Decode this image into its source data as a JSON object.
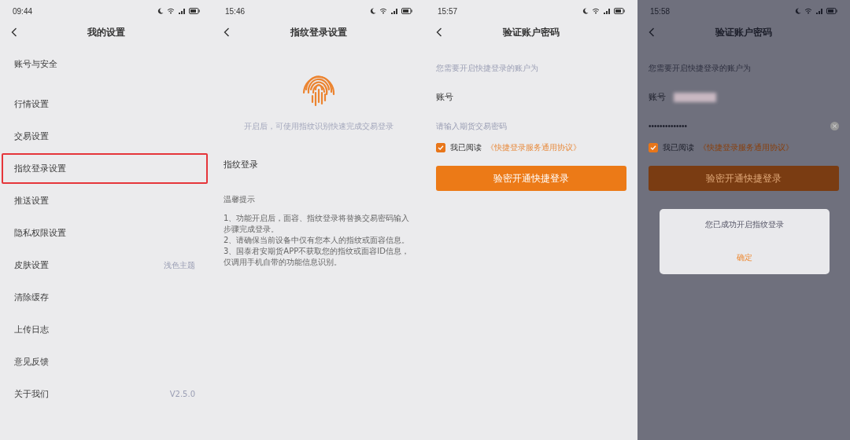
{
  "screens": [
    {
      "kind": "settings",
      "time": "09:44",
      "title": "我的设置",
      "items": [
        {
          "label": "账号与安全",
          "highlighted": false
        },
        {
          "label": "行情设置",
          "highlighted": false
        },
        {
          "label": "交易设置",
          "highlighted": false
        },
        {
          "label": "指纹登录设置",
          "highlighted": true
        },
        {
          "label": "推送设置",
          "highlighted": false
        },
        {
          "label": "隐私权限设置",
          "highlighted": false
        },
        {
          "label": "皮肤设置",
          "value": "浅色主题",
          "highlighted": false
        },
        {
          "label": "清除缓存",
          "highlighted": false
        },
        {
          "label": "上传日志",
          "highlighted": false
        },
        {
          "label": "意见反馈",
          "highlighted": false
        },
        {
          "label": "关于我们",
          "value": "V2.5.0",
          "highlighted": false
        }
      ]
    },
    {
      "kind": "fingerprint",
      "time": "15:46",
      "title": "指纹登录设置",
      "caption": "开启后，可使用指纹识别快速完成交易登录",
      "option": "指纹登录",
      "tips_title": "温馨提示",
      "tips": [
        "1、功能开启后，面容、指纹登录将替换交易密码输入步骤完成登录。",
        "2、请确保当前设备中仅有您本人的指纹或面容信息。",
        "3、国泰君安期货APP不获取您的指纹或面容ID信息，仅调用手机自带的功能信息识别。"
      ]
    },
    {
      "kind": "verify",
      "time": "15:57",
      "title": "验证账户密码",
      "caption": "您需要开启快捷登录的账户为",
      "account_label": "账号",
      "account_redacted": false,
      "password": {
        "placeholder": "请输入期货交易密码"
      },
      "agree": {
        "checked": true,
        "text": "我已阅读",
        "link": "《快捷登录服务通用协议》"
      },
      "button": "验密开通快捷登录"
    },
    {
      "kind": "verify",
      "time": "15:58",
      "title": "验证账户密码",
      "caption": "您需要开启快捷登录的账户为",
      "account_label": "账号",
      "account_redacted": true,
      "password": {
        "value": "••••••••••••••"
      },
      "agree": {
        "checked": true,
        "text": "我已阅读",
        "link": "《快捷登录服务通用协议》"
      },
      "button": "验密开通快捷登录",
      "dialog": {
        "message": "您已成功开启指纹登录",
        "button": "确定"
      }
    }
  ]
}
